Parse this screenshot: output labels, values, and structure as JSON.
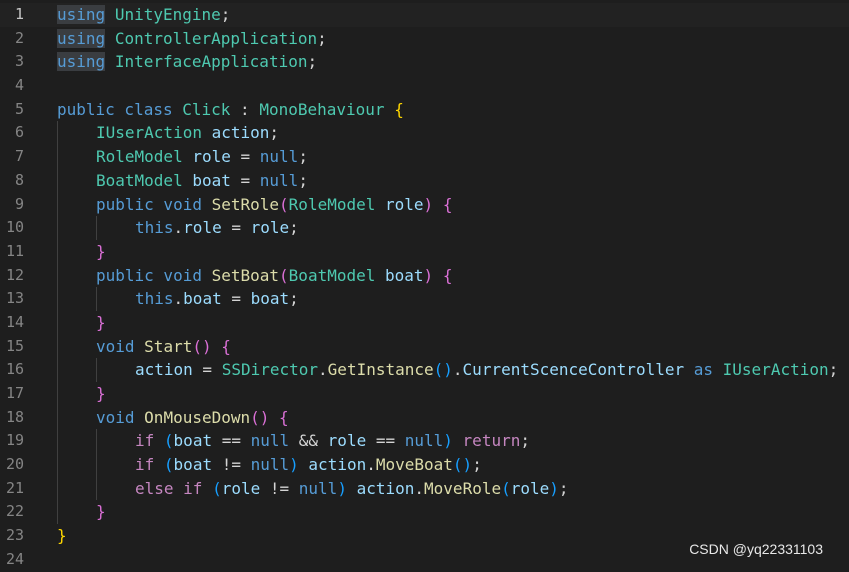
{
  "editor": {
    "language": "C#",
    "current_line": 1,
    "lines": [
      {
        "no": "1",
        "indent": 0,
        "tokens": [
          {
            "t": "using",
            "c": "kw hl"
          },
          {
            "t": " ",
            "c": "pn"
          },
          {
            "t": "UnityEngine",
            "c": "ty"
          },
          {
            "t": ";",
            "c": "pn"
          }
        ]
      },
      {
        "no": "2",
        "indent": 0,
        "tokens": [
          {
            "t": "using",
            "c": "kw hl"
          },
          {
            "t": " ",
            "c": "pn"
          },
          {
            "t": "ControllerApplication",
            "c": "ty"
          },
          {
            "t": ";",
            "c": "pn"
          }
        ]
      },
      {
        "no": "3",
        "indent": 0,
        "tokens": [
          {
            "t": "using",
            "c": "kw hl"
          },
          {
            "t": " ",
            "c": "pn"
          },
          {
            "t": "InterfaceApplication",
            "c": "ty"
          },
          {
            "t": ";",
            "c": "pn"
          }
        ]
      },
      {
        "no": "4",
        "indent": 0,
        "tokens": []
      },
      {
        "no": "5",
        "indent": 0,
        "tokens": [
          {
            "t": "public class ",
            "c": "kw"
          },
          {
            "t": "Click",
            "c": "ty"
          },
          {
            "t": " : ",
            "c": "pn"
          },
          {
            "t": "MonoBehaviour",
            "c": "ty"
          },
          {
            "t": " ",
            "c": "pn"
          },
          {
            "t": "{",
            "c": "br1"
          }
        ]
      },
      {
        "no": "6",
        "indent": 1,
        "tokens": [
          {
            "t": "IUserAction",
            "c": "ty"
          },
          {
            "t": " ",
            "c": "pn"
          },
          {
            "t": "action",
            "c": "var"
          },
          {
            "t": ";",
            "c": "pn"
          }
        ]
      },
      {
        "no": "7",
        "indent": 1,
        "tokens": [
          {
            "t": "RoleModel",
            "c": "ty"
          },
          {
            "t": " ",
            "c": "pn"
          },
          {
            "t": "role",
            "c": "var"
          },
          {
            "t": " = ",
            "c": "pn"
          },
          {
            "t": "null",
            "c": "kw"
          },
          {
            "t": ";",
            "c": "pn"
          }
        ]
      },
      {
        "no": "8",
        "indent": 1,
        "tokens": [
          {
            "t": "BoatModel",
            "c": "ty"
          },
          {
            "t": " ",
            "c": "pn"
          },
          {
            "t": "boat",
            "c": "var"
          },
          {
            "t": " = ",
            "c": "pn"
          },
          {
            "t": "null",
            "c": "kw"
          },
          {
            "t": ";",
            "c": "pn"
          }
        ]
      },
      {
        "no": "9",
        "indent": 1,
        "tokens": [
          {
            "t": "public void ",
            "c": "kw"
          },
          {
            "t": "SetRole",
            "c": "fn"
          },
          {
            "t": "(",
            "c": "br2"
          },
          {
            "t": "RoleModel",
            "c": "ty"
          },
          {
            "t": " ",
            "c": "pn"
          },
          {
            "t": "role",
            "c": "var"
          },
          {
            "t": ")",
            "c": "br2"
          },
          {
            "t": " ",
            "c": "pn"
          },
          {
            "t": "{",
            "c": "br2"
          }
        ]
      },
      {
        "no": "10",
        "indent": 2,
        "tokens": [
          {
            "t": "this",
            "c": "kw"
          },
          {
            "t": ".",
            "c": "pn"
          },
          {
            "t": "role",
            "c": "var"
          },
          {
            "t": " = ",
            "c": "pn"
          },
          {
            "t": "role",
            "c": "var"
          },
          {
            "t": ";",
            "c": "pn"
          }
        ]
      },
      {
        "no": "11",
        "indent": 1,
        "tokens": [
          {
            "t": "}",
            "c": "br2"
          }
        ]
      },
      {
        "no": "12",
        "indent": 1,
        "tokens": [
          {
            "t": "public void ",
            "c": "kw"
          },
          {
            "t": "SetBoat",
            "c": "fn"
          },
          {
            "t": "(",
            "c": "br2"
          },
          {
            "t": "BoatModel",
            "c": "ty"
          },
          {
            "t": " ",
            "c": "pn"
          },
          {
            "t": "boat",
            "c": "var"
          },
          {
            "t": ")",
            "c": "br2"
          },
          {
            "t": " ",
            "c": "pn"
          },
          {
            "t": "{",
            "c": "br2"
          }
        ]
      },
      {
        "no": "13",
        "indent": 2,
        "tokens": [
          {
            "t": "this",
            "c": "kw"
          },
          {
            "t": ".",
            "c": "pn"
          },
          {
            "t": "boat",
            "c": "var"
          },
          {
            "t": " = ",
            "c": "pn"
          },
          {
            "t": "boat",
            "c": "var"
          },
          {
            "t": ";",
            "c": "pn"
          }
        ]
      },
      {
        "no": "14",
        "indent": 1,
        "tokens": [
          {
            "t": "}",
            "c": "br2"
          }
        ]
      },
      {
        "no": "15",
        "indent": 1,
        "tokens": [
          {
            "t": "void ",
            "c": "kw"
          },
          {
            "t": "Start",
            "c": "fn"
          },
          {
            "t": "()",
            "c": "br2"
          },
          {
            "t": " ",
            "c": "pn"
          },
          {
            "t": "{",
            "c": "br2"
          }
        ]
      },
      {
        "no": "16",
        "indent": 2,
        "tokens": [
          {
            "t": "action",
            "c": "var"
          },
          {
            "t": " = ",
            "c": "pn"
          },
          {
            "t": "SSDirector",
            "c": "ty"
          },
          {
            "t": ".",
            "c": "pn"
          },
          {
            "t": "GetInstance",
            "c": "fn"
          },
          {
            "t": "()",
            "c": "br3"
          },
          {
            "t": ".",
            "c": "pn"
          },
          {
            "t": "CurrentScenceController",
            "c": "var"
          },
          {
            "t": " ",
            "c": "pn"
          },
          {
            "t": "as",
            "c": "kw"
          },
          {
            "t": " ",
            "c": "pn"
          },
          {
            "t": "IUserAction",
            "c": "ty"
          },
          {
            "t": ";",
            "c": "pn"
          }
        ]
      },
      {
        "no": "17",
        "indent": 1,
        "tokens": [
          {
            "t": "}",
            "c": "br2"
          }
        ]
      },
      {
        "no": "18",
        "indent": 1,
        "tokens": [
          {
            "t": "void ",
            "c": "kw"
          },
          {
            "t": "OnMouseDown",
            "c": "fn"
          },
          {
            "t": "()",
            "c": "br2"
          },
          {
            "t": " ",
            "c": "pn"
          },
          {
            "t": "{",
            "c": "br2"
          }
        ]
      },
      {
        "no": "19",
        "indent": 2,
        "tokens": [
          {
            "t": "if",
            "c": "ctl"
          },
          {
            "t": " ",
            "c": "pn"
          },
          {
            "t": "(",
            "c": "br3"
          },
          {
            "t": "boat",
            "c": "var"
          },
          {
            "t": " == ",
            "c": "pn"
          },
          {
            "t": "null",
            "c": "kw"
          },
          {
            "t": " && ",
            "c": "pn"
          },
          {
            "t": "role",
            "c": "var"
          },
          {
            "t": " == ",
            "c": "pn"
          },
          {
            "t": "null",
            "c": "kw"
          },
          {
            "t": ")",
            "c": "br3"
          },
          {
            "t": " ",
            "c": "pn"
          },
          {
            "t": "return",
            "c": "ctl"
          },
          {
            "t": ";",
            "c": "pn"
          }
        ]
      },
      {
        "no": "20",
        "indent": 2,
        "tokens": [
          {
            "t": "if",
            "c": "ctl"
          },
          {
            "t": " ",
            "c": "pn"
          },
          {
            "t": "(",
            "c": "br3"
          },
          {
            "t": "boat",
            "c": "var"
          },
          {
            "t": " != ",
            "c": "pn"
          },
          {
            "t": "null",
            "c": "kw"
          },
          {
            "t": ")",
            "c": "br3"
          },
          {
            "t": " ",
            "c": "pn"
          },
          {
            "t": "action",
            "c": "var"
          },
          {
            "t": ".",
            "c": "pn"
          },
          {
            "t": "MoveBoat",
            "c": "fn"
          },
          {
            "t": "()",
            "c": "br3"
          },
          {
            "t": ";",
            "c": "pn"
          }
        ]
      },
      {
        "no": "21",
        "indent": 2,
        "tokens": [
          {
            "t": "else if",
            "c": "ctl"
          },
          {
            "t": " ",
            "c": "pn"
          },
          {
            "t": "(",
            "c": "br3"
          },
          {
            "t": "role",
            "c": "var"
          },
          {
            "t": " != ",
            "c": "pn"
          },
          {
            "t": "null",
            "c": "kw"
          },
          {
            "t": ")",
            "c": "br3"
          },
          {
            "t": " ",
            "c": "pn"
          },
          {
            "t": "action",
            "c": "var"
          },
          {
            "t": ".",
            "c": "pn"
          },
          {
            "t": "MoveRole",
            "c": "fn"
          },
          {
            "t": "(",
            "c": "br3"
          },
          {
            "t": "role",
            "c": "var"
          },
          {
            "t": ")",
            "c": "br3"
          },
          {
            "t": ";",
            "c": "pn"
          }
        ]
      },
      {
        "no": "22",
        "indent": 1,
        "tokens": [
          {
            "t": "}",
            "c": "br2"
          }
        ]
      },
      {
        "no": "23",
        "indent": 0,
        "tokens": [
          {
            "t": "}",
            "c": "br1"
          }
        ]
      },
      {
        "no": "24",
        "indent": 0,
        "tokens": []
      }
    ]
  },
  "watermark": "CSDN @yq22331103",
  "colors": {
    "background": "#1e1e1e",
    "keyword": "#569cd6",
    "control": "#c586c0",
    "type": "#4ec9b0",
    "function": "#dcdcaa",
    "variable": "#9cdcfe",
    "bracket_level1": "#ffd700",
    "bracket_level2": "#da70d6",
    "bracket_level3": "#179fff"
  }
}
